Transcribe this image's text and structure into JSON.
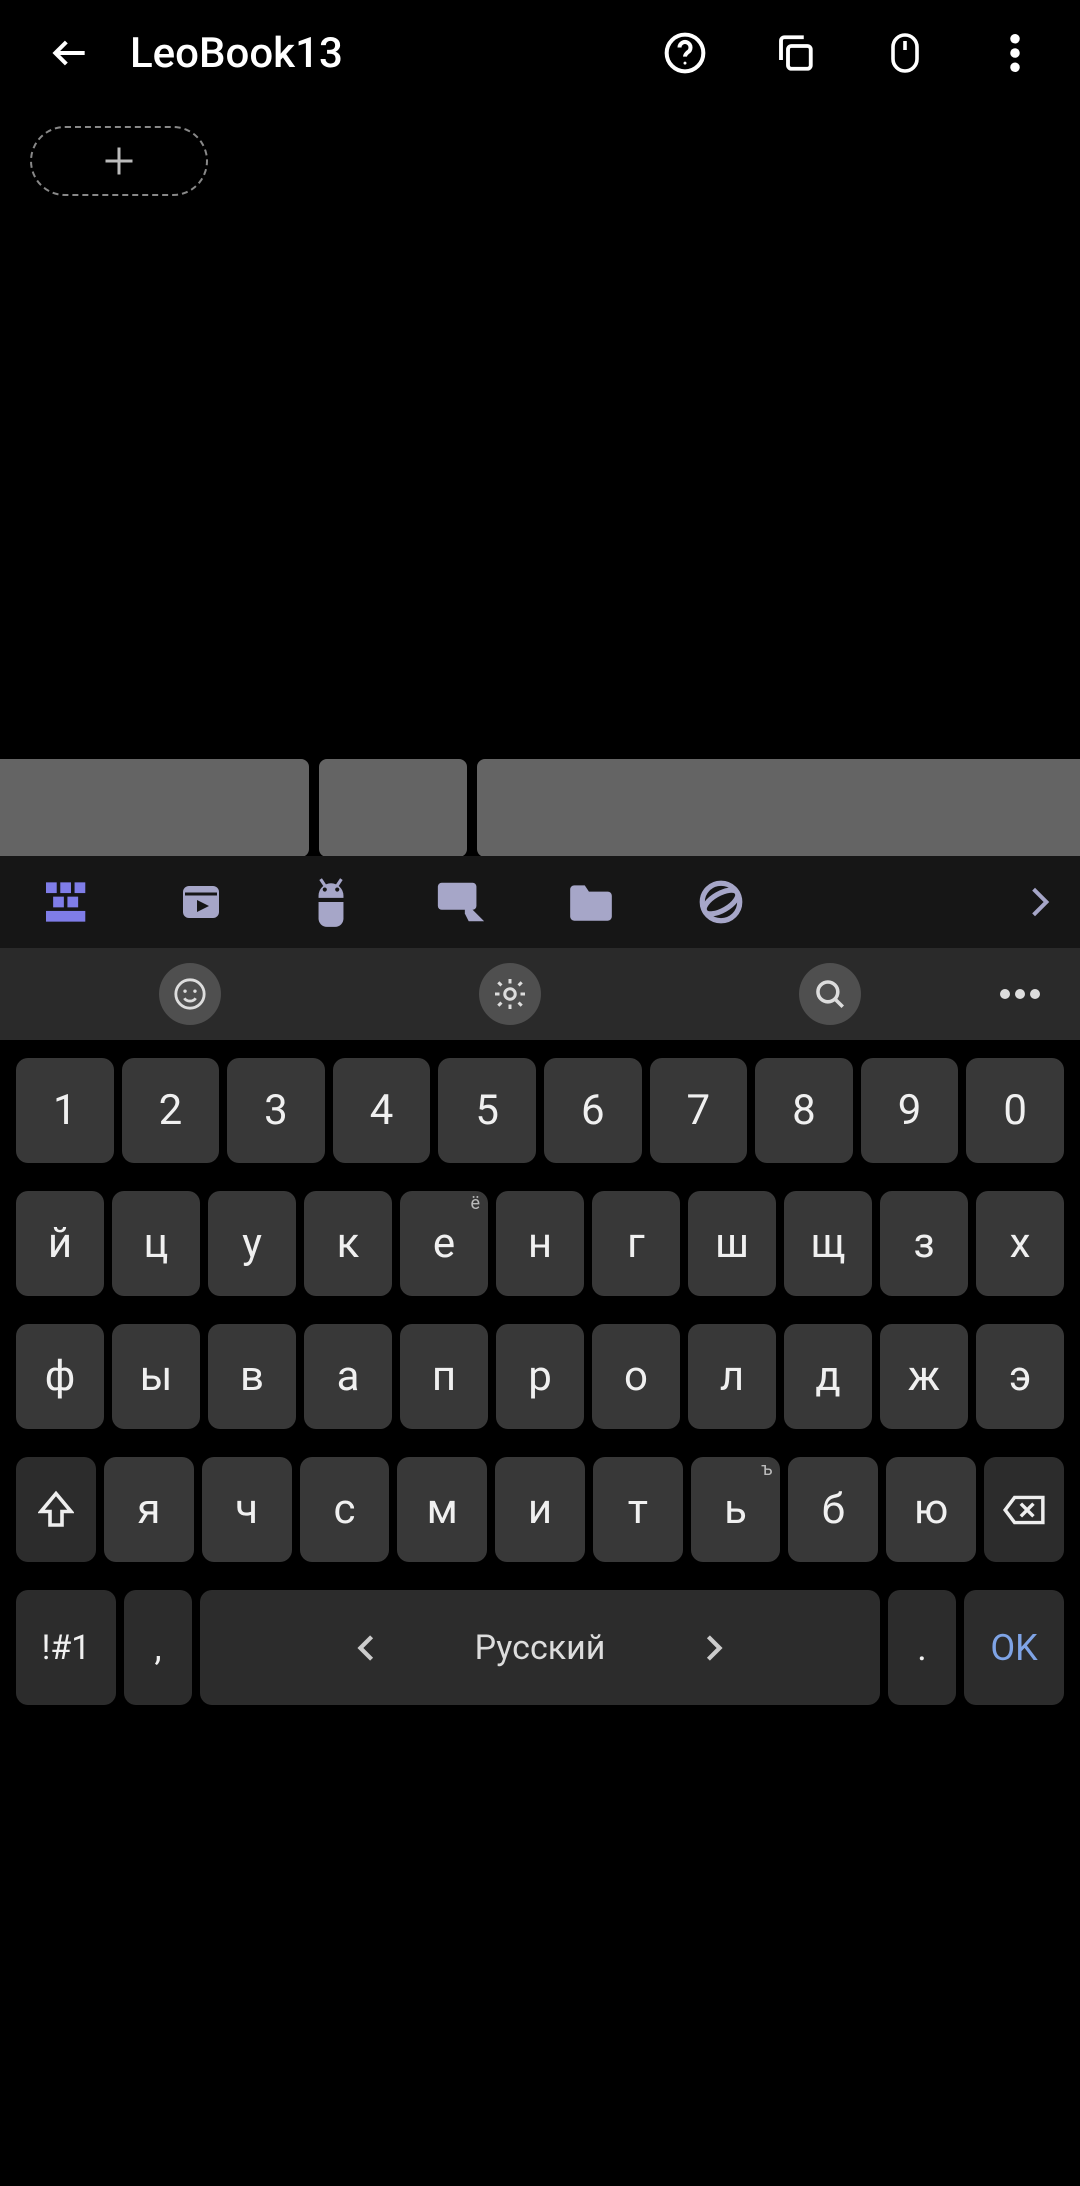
{
  "appbar": {
    "title": "LeoBook13"
  },
  "taskbar": {
    "items": [
      "keyboard-icon",
      "video-icon",
      "android-icon",
      "screen-share-icon",
      "folder-icon",
      "planet-icon",
      "chevron-right-icon"
    ]
  },
  "keyboard": {
    "language": "Русский",
    "ok_label": "OK",
    "sym_label": "!#1",
    "row_num": [
      "1",
      "2",
      "3",
      "4",
      "5",
      "6",
      "7",
      "8",
      "9",
      "0"
    ],
    "row1": [
      "й",
      "ц",
      "у",
      "к",
      "е",
      "н",
      "г",
      "ш",
      "щ",
      "з",
      "х"
    ],
    "row1_sup": {
      "е": "ё"
    },
    "row2": [
      "ф",
      "ы",
      "в",
      "а",
      "п",
      "р",
      "о",
      "л",
      "д",
      "ж",
      "э"
    ],
    "row3": [
      "я",
      "ч",
      "с",
      "м",
      "и",
      "т",
      "ь",
      "б",
      "ю"
    ],
    "row3_sup": {
      "ь": "ъ"
    },
    "comma": ",",
    "period": "."
  }
}
